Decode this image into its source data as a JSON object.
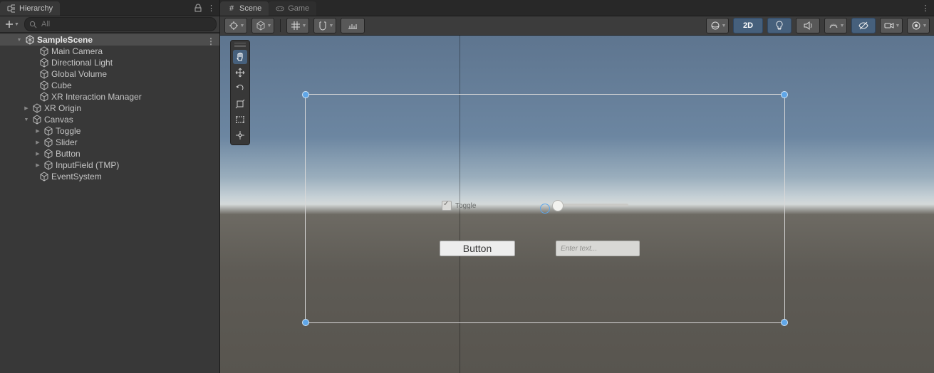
{
  "hierarchy_panel": {
    "title": "Hierarchy",
    "search_placeholder": "All",
    "scene_name": "SampleScene",
    "tree": {
      "root_items": [
        {
          "label": "Main Camera",
          "children": false
        },
        {
          "label": "Directional Light",
          "children": false
        },
        {
          "label": "Global Volume",
          "children": false
        },
        {
          "label": "Cube",
          "children": false
        },
        {
          "label": "XR Interaction Manager",
          "children": false
        },
        {
          "label": "XR Origin",
          "children": true
        },
        {
          "label": "Canvas",
          "children": true,
          "expanded": true,
          "items": [
            {
              "label": "Toggle",
              "children": true
            },
            {
              "label": "Slider",
              "children": true
            },
            {
              "label": "Button",
              "children": true
            },
            {
              "label": "InputField (TMP)",
              "children": true
            }
          ]
        },
        {
          "label": "EventSystem",
          "children": false
        }
      ]
    }
  },
  "scene_panel": {
    "tabs": {
      "scene": "Scene",
      "game": "Game"
    },
    "toolbar_right": {
      "mode_2d": "2D"
    },
    "canvas_ui": {
      "toggle_label": "Toggle",
      "button_label": "Button",
      "input_placeholder": "Enter text..."
    }
  }
}
